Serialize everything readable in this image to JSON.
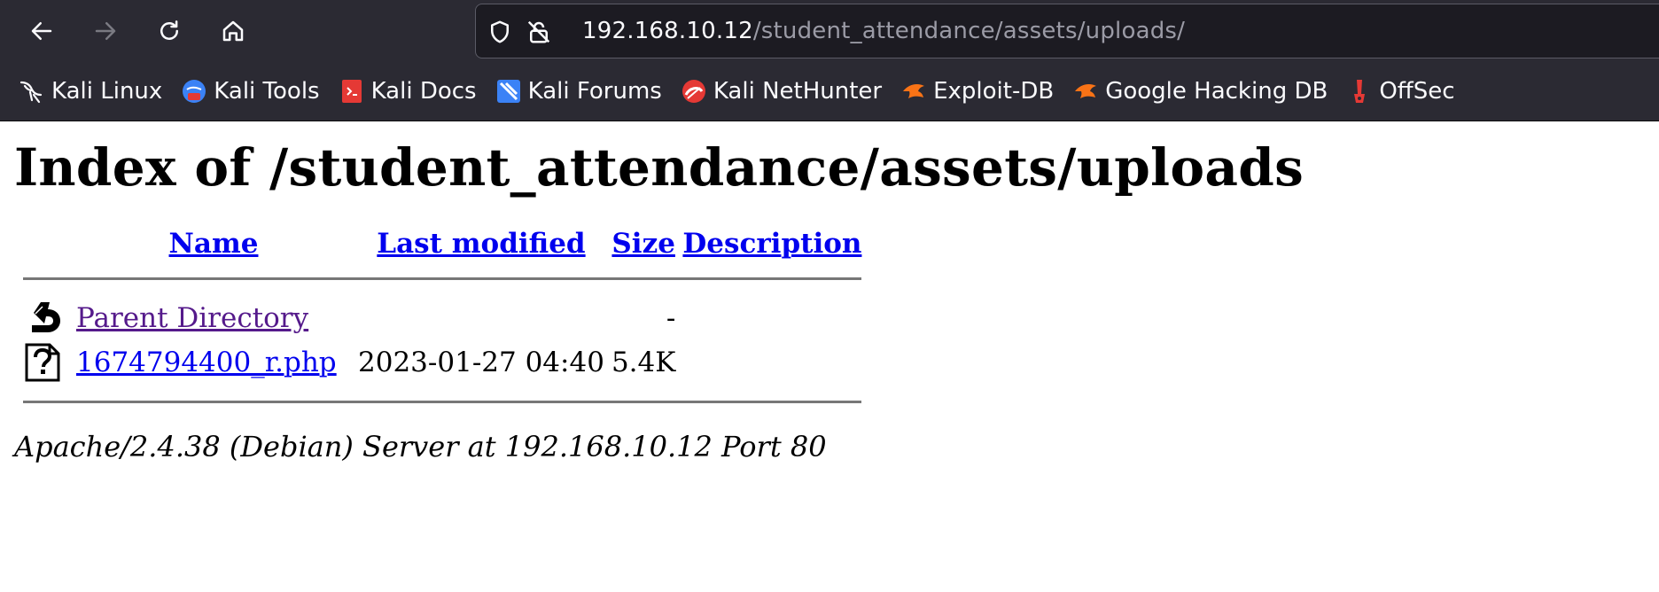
{
  "browser": {
    "url_host": "192.168.10.12",
    "url_path": "/student_attendance/assets/uploads/",
    "bookmarks": [
      {
        "label": "Kali Linux",
        "icon": "kali-dragon-icon"
      },
      {
        "label": "Kali Tools",
        "icon": "kali-tools-icon"
      },
      {
        "label": "Kali Docs",
        "icon": "kali-docs-icon"
      },
      {
        "label": "Kali Forums",
        "icon": "kali-forums-icon"
      },
      {
        "label": "Kali NetHunter",
        "icon": "kali-nethunter-icon"
      },
      {
        "label": "Exploit-DB",
        "icon": "exploit-db-icon"
      },
      {
        "label": "Google Hacking DB",
        "icon": "google-hacking-db-icon"
      },
      {
        "label": "OffSec",
        "icon": "offsec-icon"
      }
    ]
  },
  "page": {
    "title": "Index of /student_attendance/assets/uploads",
    "columns": {
      "name": "Name",
      "last_modified": "Last modified",
      "size": "Size",
      "description": "Description"
    },
    "rows": [
      {
        "name": "Parent Directory",
        "last_modified": "",
        "size": "-",
        "description": "",
        "icon": "back-folder-icon"
      },
      {
        "name": "1674794400_r.php",
        "last_modified": "2023-01-27 04:40",
        "size": "5.4K",
        "description": "",
        "icon": "unknown-file-icon"
      }
    ],
    "footer": "Apache/2.4.38 (Debian) Server at 192.168.10.12 Port 80"
  },
  "colors": {
    "toolbar_bg": "#2b2a33",
    "urlbar_bg": "#1c1b22",
    "link": "#0000ee",
    "visited_link": "#551a8b"
  }
}
